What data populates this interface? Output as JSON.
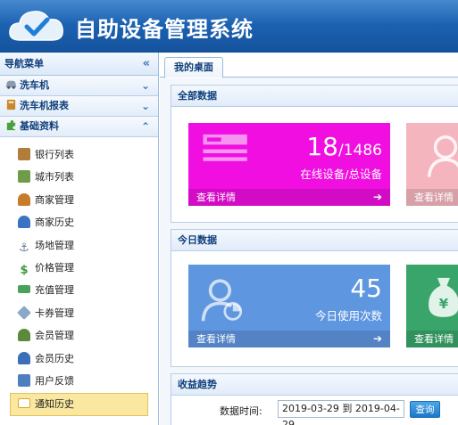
{
  "app": {
    "title": "自助设备管理系统"
  },
  "sidebar": {
    "header": "导航菜单",
    "collapse_glyph": "«",
    "groups": [
      {
        "label": "洗车机",
        "chevron": "⌄"
      },
      {
        "label": "洗车机报表",
        "chevron": "⌄"
      },
      {
        "label": "基础资料",
        "chevron": "⌃"
      }
    ],
    "items": [
      {
        "label": "银行列表",
        "icon": "bank-icon",
        "color": "#b07d3b"
      },
      {
        "label": "城市列表",
        "icon": "map-icon",
        "color": "#6f9c48"
      },
      {
        "label": "商家管理",
        "icon": "merchant-user-icon",
        "color": "#c77c2a"
      },
      {
        "label": "商家历史",
        "icon": "merchant-history-icon",
        "color": "#3b73c4"
      },
      {
        "label": "场地管理",
        "icon": "anchor-icon",
        "color": "#6b7c8c"
      },
      {
        "label": "价格管理",
        "icon": "dollar-icon",
        "color": "#3f9a3a"
      },
      {
        "label": "充值管理",
        "icon": "money-icon",
        "color": "#4aa25a"
      },
      {
        "label": "卡券管理",
        "icon": "tag-icon",
        "color": "#8aa8c8"
      },
      {
        "label": "会员管理",
        "icon": "member-icon",
        "color": "#5b8a3a"
      },
      {
        "label": "会员历史",
        "icon": "member-history-icon",
        "color": "#3b6fb8"
      },
      {
        "label": "用户反馈",
        "icon": "feedback-icon",
        "color": "#4d7fc1"
      },
      {
        "label": "通知历史",
        "icon": "mail-icon",
        "color": "#d9a82b"
      }
    ],
    "active_item": "通知历史"
  },
  "tabs": [
    {
      "label": "我的桌面"
    }
  ],
  "sections": {
    "all_data": {
      "title": "全部数据",
      "card1": {
        "value": "18",
        "total": "/1486",
        "caption": "在线设备/总设备",
        "link": "查看详情",
        "color": "#f00ee0"
      },
      "card2": {
        "link": "查看详情",
        "color": "#f5b5bf"
      }
    },
    "today": {
      "title": "今日数据",
      "card1": {
        "value": "45",
        "caption": "今日使用次数",
        "link": "查看详情",
        "color": "#5f96e0"
      },
      "card2": {
        "link": "查看详情",
        "color": "#3aa56a"
      }
    },
    "trend": {
      "title": "收益趋势",
      "date_label": "数据时间:",
      "date_range": "2019-03-29 到 2019-04-29",
      "query_button": "查询"
    }
  }
}
